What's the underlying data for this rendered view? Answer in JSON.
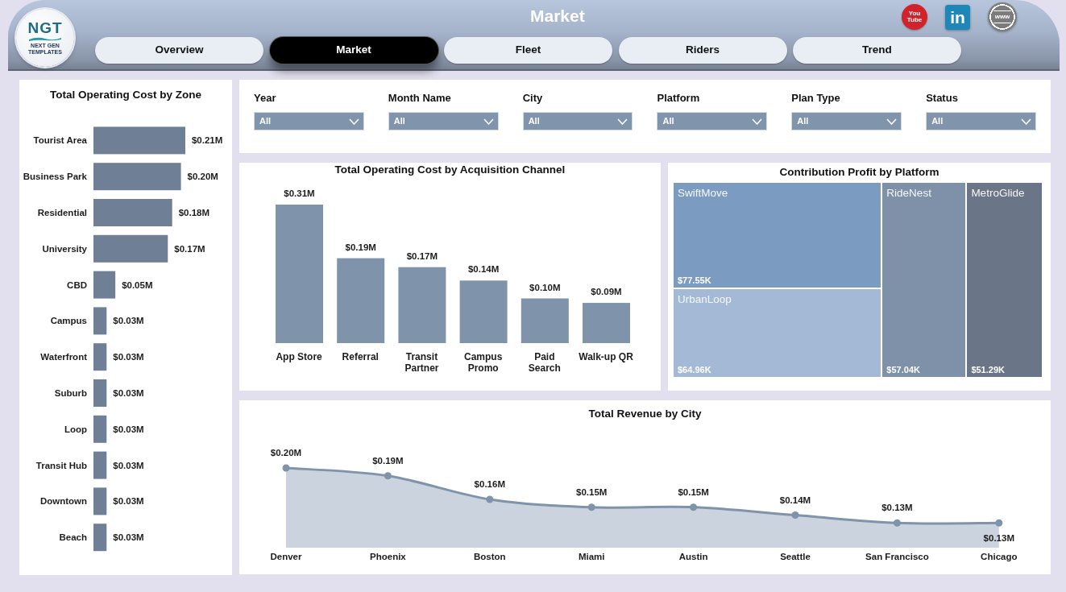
{
  "header": {
    "logo": {
      "mark": "NGT",
      "tagline": "NEXT GEN TEMPLATES"
    },
    "title": "Market",
    "links": [
      {
        "kind": "video",
        "label": "You Tube"
      },
      {
        "kind": "network",
        "label": "in"
      },
      {
        "kind": "web",
        "label": "www"
      }
    ],
    "tabs": [
      {
        "label": "Overview",
        "selected": false
      },
      {
        "label": "Market",
        "selected": true
      },
      {
        "label": "Fleet",
        "selected": false
      },
      {
        "label": "Riders",
        "selected": false
      },
      {
        "label": "Trend",
        "selected": false
      }
    ]
  },
  "zone_chart": {
    "chart_data": {
      "type": "bar",
      "orientation": "horizontal",
      "title": "Total Operating Cost by Zone",
      "categories": [
        "Tourist Area",
        "Business Park",
        "Residential",
        "University",
        "CBD",
        "Campus",
        "Waterfront",
        "Suburb",
        "Loop",
        "Transit Hub",
        "Downtown",
        "Beach"
      ],
      "values": [
        0.21,
        0.2,
        0.18,
        0.17,
        0.05,
        0.03,
        0.03,
        0.03,
        0.03,
        0.03,
        0.03,
        0.03
      ],
      "value_labels": [
        "$0.21M",
        "$0.20M",
        "$0.18M",
        "$0.17M",
        "$0.05M",
        "$0.03M",
        "$0.03M",
        "$0.03M",
        "$0.03M",
        "$0.03M",
        "$0.03M",
        "$0.03M"
      ]
    }
  },
  "filters": [
    {
      "label": "Year",
      "value": "All"
    },
    {
      "label": "Month Name",
      "value": "All"
    },
    {
      "label": "City",
      "value": "All"
    },
    {
      "label": "Platform",
      "value": "All"
    },
    {
      "label": "Plan Type",
      "value": "All"
    },
    {
      "label": "Status",
      "value": "All"
    }
  ],
  "channel_chart": {
    "chart_data": {
      "type": "bar",
      "orientation": "vertical",
      "title": "Total Operating Cost by Acquisition Channel",
      "categories": [
        "App Store",
        "Referral",
        "Transit Partner",
        "Campus Promo",
        "Paid Search",
        "Walk-up QR"
      ],
      "values": [
        0.31,
        0.19,
        0.17,
        0.14,
        0.1,
        0.09
      ],
      "value_labels": [
        "$0.31M",
        "$0.19M",
        "$0.17M",
        "$0.14M",
        "$0.10M",
        "$0.09M"
      ]
    }
  },
  "platform_treemap": {
    "title": "Contribution Profit by Platform",
    "tiles": [
      {
        "name": "SwiftMove",
        "value": "$77.55K",
        "color": "#7b9bc0"
      },
      {
        "name": "UrbanLoop",
        "value": "$64.96K",
        "color": "#a3b9d6"
      },
      {
        "name": "RideNest",
        "value": "$57.04K",
        "color": "#7f91a9"
      },
      {
        "name": "MetroGlide",
        "value": "$51.29K",
        "color": "#6a7587"
      }
    ]
  },
  "city_chart": {
    "chart_data": {
      "type": "area",
      "title": "Total Revenue by City",
      "categories": [
        "Denver",
        "Phoenix",
        "Boston",
        "Miami",
        "Austin",
        "Seattle",
        "San Francisco",
        "Chicago"
      ],
      "values": [
        0.2,
        0.19,
        0.16,
        0.15,
        0.15,
        0.14,
        0.13,
        0.13
      ],
      "value_labels": [
        "$0.20M",
        "$0.19M",
        "$0.16M",
        "$0.15M",
        "$0.15M",
        "$0.14M",
        "$0.13M",
        "$0.13M"
      ]
    }
  }
}
